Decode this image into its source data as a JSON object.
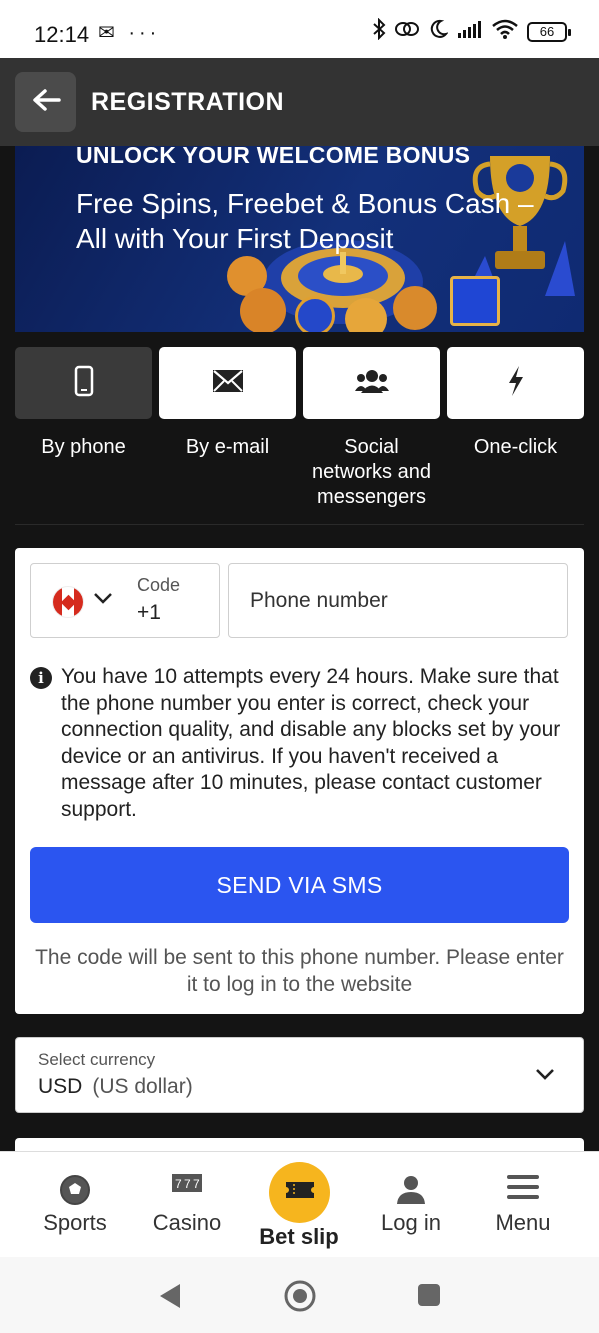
{
  "status_bar": {
    "time": "12:14",
    "left_icons": "✉ ···",
    "battery": "66"
  },
  "header": {
    "title": "REGISTRATION"
  },
  "banner": {
    "heading": "UNLOCK YOUR WELCOME BONUS",
    "text": "Free Spins, Freebet & Bonus Cash – All with Your First Deposit"
  },
  "methods": [
    {
      "label": "By phone",
      "icon": "phone-icon",
      "active": true
    },
    {
      "label": "By e-mail",
      "icon": "envelope-icon",
      "active": false
    },
    {
      "label": "Social networks and messengers",
      "icon": "users-icon",
      "active": false
    },
    {
      "label": "One-click",
      "icon": "lightning-icon",
      "active": false
    }
  ],
  "form": {
    "code_label": "Code",
    "code_value": "+1",
    "country_flag": "canada-flag-icon",
    "phone_placeholder": "Phone number",
    "info_text": "You have 10 attempts every 24 hours. Make sure that the phone number you enter is correct, check your connection quality, and disable any blocks set by your device or an antivirus. If you haven't received a message after 10 minutes, please contact customer support.",
    "send_button": "SEND VIA SMS",
    "send_note": "The code will be sent to this phone number. Please enter it to log in to the website"
  },
  "currency": {
    "label": "Select currency",
    "value": "USD",
    "value_name": "(US dollar)"
  },
  "bottom_nav": {
    "items": [
      {
        "label": "Sports",
        "icon": "soccer-ball-icon"
      },
      {
        "label": "Casino",
        "icon": "slot-777-icon"
      },
      {
        "label": "Bet slip",
        "icon": "ticket-icon"
      },
      {
        "label": "Log in",
        "icon": "user-icon"
      },
      {
        "label": "Menu",
        "icon": "hamburger-icon"
      }
    ]
  },
  "colors": {
    "background": "#141414",
    "header": "#333333",
    "primary_button": "#2b55f0",
    "bet_slip_accent": "#f6b51e"
  }
}
